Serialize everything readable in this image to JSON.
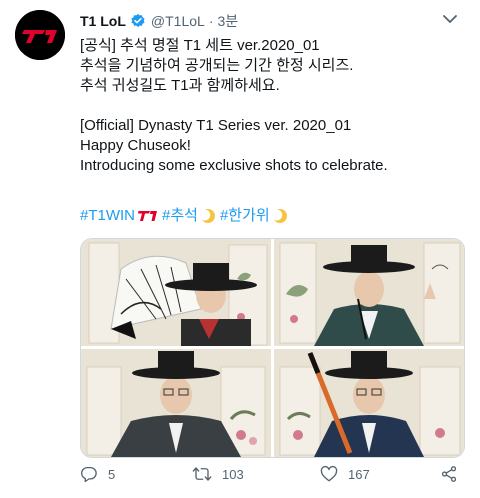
{
  "tweet": {
    "author_name": "T1 LoL",
    "handle": "@T1LoL",
    "separator": "·",
    "time": "3분",
    "lines": [
      "[공식] 추석 명절 T1 세트 ver.2020_01",
      "추석을 기념하여 공개되는 기간 한정 시리즈.",
      "추석 귀성길도 T1과 함께하세요.",
      "",
      "[Official] Dynasty T1 Series ver. 2020_01",
      "Happy Chuseok!",
      "Introducing some exclusive shots to celebrate."
    ],
    "hashtags": [
      "#T1WIN",
      "#추석",
      "#한가위"
    ]
  },
  "media": {
    "photo_count": 4,
    "palette": {
      "wall": "#e9e3d6",
      "panel": "#f3efe6",
      "hat": "#1b1b1b",
      "hanbok_dark": "#3a3f44",
      "hanbok_teal": "#2f4b4a",
      "hanbok_navy": "#243552",
      "red": "#c83a3a"
    }
  },
  "actions": {
    "replies": "5",
    "retweets": "103",
    "likes": "167"
  },
  "icons": [
    "verified-badge-icon",
    "more-icon",
    "reply-icon",
    "retweet-icon",
    "like-icon",
    "share-icon",
    "t1-logo-icon",
    "moon-emoji-icon"
  ],
  "colors": {
    "accent": "#1d9bf0",
    "secondary_text": "#536471",
    "brand_red": "#e2012d"
  }
}
